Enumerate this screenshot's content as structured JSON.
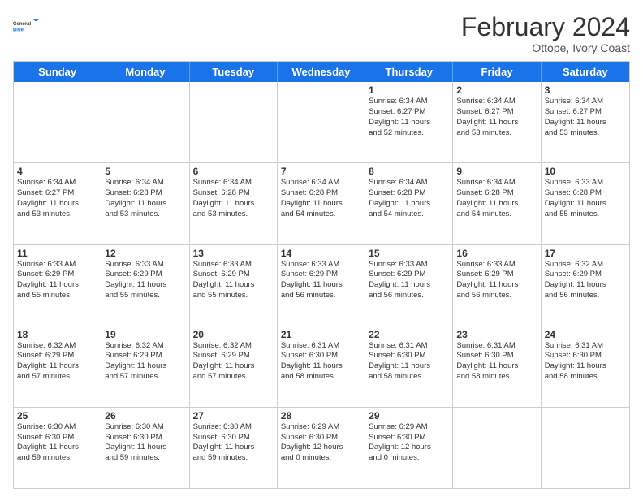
{
  "logo": {
    "general": "General",
    "blue": "Blue"
  },
  "title": "February 2024",
  "subtitle": "Ottope, Ivory Coast",
  "days_of_week": [
    "Sunday",
    "Monday",
    "Tuesday",
    "Wednesday",
    "Thursday",
    "Friday",
    "Saturday"
  ],
  "rows": [
    [
      {
        "day": "",
        "info": "",
        "empty": true
      },
      {
        "day": "",
        "info": "",
        "empty": true
      },
      {
        "day": "",
        "info": "",
        "empty": true
      },
      {
        "day": "",
        "info": "",
        "empty": true
      },
      {
        "day": "1",
        "info": "Sunrise: 6:34 AM\nSunset: 6:27 PM\nDaylight: 11 hours\nand 52 minutes.",
        "empty": false
      },
      {
        "day": "2",
        "info": "Sunrise: 6:34 AM\nSunset: 6:27 PM\nDaylight: 11 hours\nand 53 minutes.",
        "empty": false
      },
      {
        "day": "3",
        "info": "Sunrise: 6:34 AM\nSunset: 6:27 PM\nDaylight: 11 hours\nand 53 minutes.",
        "empty": false
      }
    ],
    [
      {
        "day": "4",
        "info": "Sunrise: 6:34 AM\nSunset: 6:27 PM\nDaylight: 11 hours\nand 53 minutes.",
        "empty": false
      },
      {
        "day": "5",
        "info": "Sunrise: 6:34 AM\nSunset: 6:28 PM\nDaylight: 11 hours\nand 53 minutes.",
        "empty": false
      },
      {
        "day": "6",
        "info": "Sunrise: 6:34 AM\nSunset: 6:28 PM\nDaylight: 11 hours\nand 53 minutes.",
        "empty": false
      },
      {
        "day": "7",
        "info": "Sunrise: 6:34 AM\nSunset: 6:28 PM\nDaylight: 11 hours\nand 54 minutes.",
        "empty": false
      },
      {
        "day": "8",
        "info": "Sunrise: 6:34 AM\nSunset: 6:28 PM\nDaylight: 11 hours\nand 54 minutes.",
        "empty": false
      },
      {
        "day": "9",
        "info": "Sunrise: 6:34 AM\nSunset: 6:28 PM\nDaylight: 11 hours\nand 54 minutes.",
        "empty": false
      },
      {
        "day": "10",
        "info": "Sunrise: 6:33 AM\nSunset: 6:28 PM\nDaylight: 11 hours\nand 55 minutes.",
        "empty": false
      }
    ],
    [
      {
        "day": "11",
        "info": "Sunrise: 6:33 AM\nSunset: 6:29 PM\nDaylight: 11 hours\nand 55 minutes.",
        "empty": false
      },
      {
        "day": "12",
        "info": "Sunrise: 6:33 AM\nSunset: 6:29 PM\nDaylight: 11 hours\nand 55 minutes.",
        "empty": false
      },
      {
        "day": "13",
        "info": "Sunrise: 6:33 AM\nSunset: 6:29 PM\nDaylight: 11 hours\nand 55 minutes.",
        "empty": false
      },
      {
        "day": "14",
        "info": "Sunrise: 6:33 AM\nSunset: 6:29 PM\nDaylight: 11 hours\nand 56 minutes.",
        "empty": false
      },
      {
        "day": "15",
        "info": "Sunrise: 6:33 AM\nSunset: 6:29 PM\nDaylight: 11 hours\nand 56 minutes.",
        "empty": false
      },
      {
        "day": "16",
        "info": "Sunrise: 6:33 AM\nSunset: 6:29 PM\nDaylight: 11 hours\nand 56 minutes.",
        "empty": false
      },
      {
        "day": "17",
        "info": "Sunrise: 6:32 AM\nSunset: 6:29 PM\nDaylight: 11 hours\nand 56 minutes.",
        "empty": false
      }
    ],
    [
      {
        "day": "18",
        "info": "Sunrise: 6:32 AM\nSunset: 6:29 PM\nDaylight: 11 hours\nand 57 minutes.",
        "empty": false
      },
      {
        "day": "19",
        "info": "Sunrise: 6:32 AM\nSunset: 6:29 PM\nDaylight: 11 hours\nand 57 minutes.",
        "empty": false
      },
      {
        "day": "20",
        "info": "Sunrise: 6:32 AM\nSunset: 6:29 PM\nDaylight: 11 hours\nand 57 minutes.",
        "empty": false
      },
      {
        "day": "21",
        "info": "Sunrise: 6:31 AM\nSunset: 6:30 PM\nDaylight: 11 hours\nand 58 minutes.",
        "empty": false
      },
      {
        "day": "22",
        "info": "Sunrise: 6:31 AM\nSunset: 6:30 PM\nDaylight: 11 hours\nand 58 minutes.",
        "empty": false
      },
      {
        "day": "23",
        "info": "Sunrise: 6:31 AM\nSunset: 6:30 PM\nDaylight: 11 hours\nand 58 minutes.",
        "empty": false
      },
      {
        "day": "24",
        "info": "Sunrise: 6:31 AM\nSunset: 6:30 PM\nDaylight: 11 hours\nand 58 minutes.",
        "empty": false
      }
    ],
    [
      {
        "day": "25",
        "info": "Sunrise: 6:30 AM\nSunset: 6:30 PM\nDaylight: 11 hours\nand 59 minutes.",
        "empty": false
      },
      {
        "day": "26",
        "info": "Sunrise: 6:30 AM\nSunset: 6:30 PM\nDaylight: 11 hours\nand 59 minutes.",
        "empty": false
      },
      {
        "day": "27",
        "info": "Sunrise: 6:30 AM\nSunset: 6:30 PM\nDaylight: 11 hours\nand 59 minutes.",
        "empty": false
      },
      {
        "day": "28",
        "info": "Sunrise: 6:29 AM\nSunset: 6:30 PM\nDaylight: 12 hours\nand 0 minutes.",
        "empty": false
      },
      {
        "day": "29",
        "info": "Sunrise: 6:29 AM\nSunset: 6:30 PM\nDaylight: 12 hours\nand 0 minutes.",
        "empty": false
      },
      {
        "day": "",
        "info": "",
        "empty": true
      },
      {
        "day": "",
        "info": "",
        "empty": true
      }
    ]
  ]
}
